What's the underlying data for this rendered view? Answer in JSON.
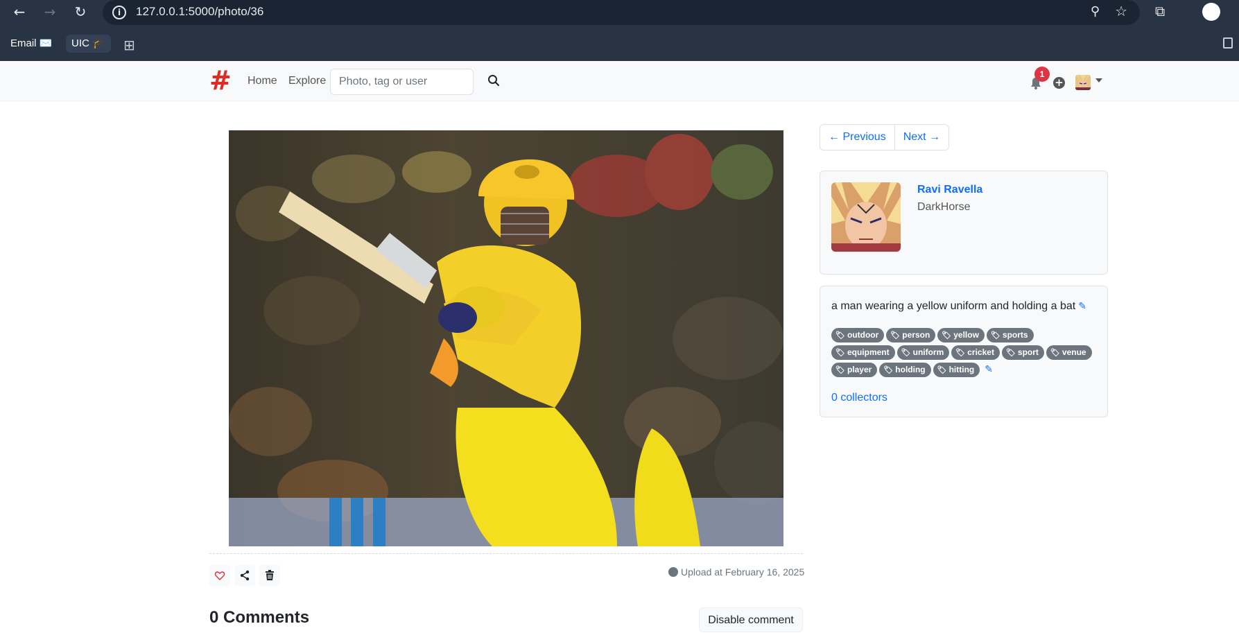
{
  "browser": {
    "url": "127.0.0.1:5000/photo/36",
    "bookmarks": [
      {
        "label": "Email ✉️"
      },
      {
        "label": "UIC 🎓"
      }
    ]
  },
  "navbar": {
    "logo": "#",
    "links": {
      "home": "Home",
      "explore": "Explore"
    },
    "search_placeholder": "Photo, tag or user",
    "notification_count": "1"
  },
  "photo": {
    "description": "a man wearing a yellow uniform and holding a bat",
    "upload_text": "Upload at February 16, 2025"
  },
  "pager": {
    "previous": "← Previous",
    "next": "Next →"
  },
  "user": {
    "name": "Ravi Ravella",
    "handle": "DarkHorse"
  },
  "tags": [
    [
      "outdoor",
      "person",
      "yellow",
      "sports"
    ],
    [
      "equipment",
      "uniform",
      "cricket",
      "sport",
      "venue"
    ],
    [
      "player",
      "holding",
      "hitting"
    ]
  ],
  "collectors": "0 collectors",
  "comments": {
    "title": "0 Comments",
    "disable_label": "Disable comment"
  },
  "colors": {
    "primary": "#0d6efd",
    "tag_bg": "#6c757d",
    "badge": "#dc3545",
    "logo": "#e02b20"
  }
}
